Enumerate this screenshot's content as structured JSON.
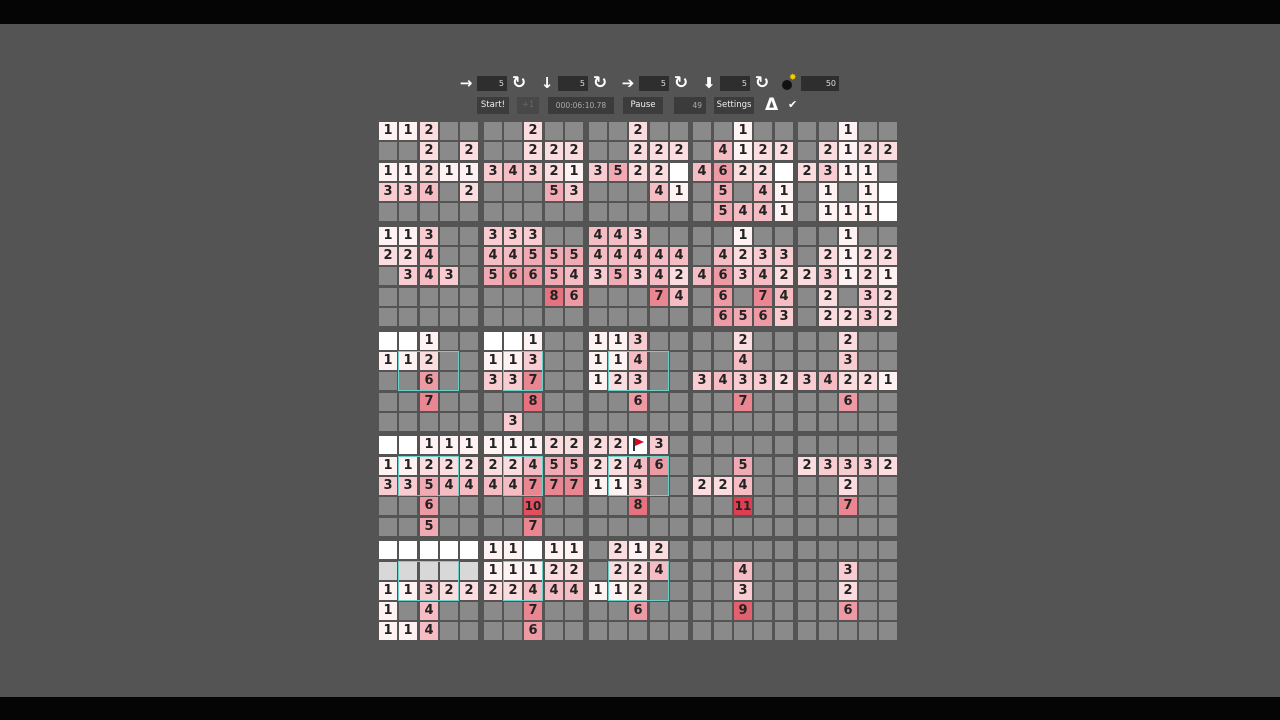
{
  "controls": {
    "move_right_value": "5",
    "move_down_value": "5",
    "move_right_fast_value": "5",
    "move_down_fast_value": "5",
    "mine_count": "50"
  },
  "buttons": {
    "start": "Start!",
    "step": "+1",
    "pause": "Pause",
    "settings": "Settings"
  },
  "status": {
    "timer": "000:06:10.78",
    "remaining": "49"
  },
  "colors": {
    "background": "#545454",
    "hidden_cell": "#8a8a8a",
    "revealed_cell": "#ffffff",
    "hint_outline": "#6bd0c8",
    "flag": "#e00020"
  },
  "grid": {
    "block_size": 5,
    "blocks": 5,
    "rows": [
      [
        "1",
        "1",
        "2",
        ".",
        ".",
        ".",
        ".",
        "2",
        ".",
        ".",
        ".",
        ".",
        "2",
        ".",
        ".",
        ".",
        ".",
        "1",
        ".",
        ".",
        ".",
        ".",
        "1",
        ".",
        "."
      ],
      [
        ".",
        ".",
        "2",
        ".",
        "2",
        ".",
        ".",
        "2",
        "2",
        "2",
        ".",
        ".",
        "2",
        "2",
        "2",
        ".",
        "4",
        "1",
        "2",
        "2",
        ".",
        "2",
        "1",
        "2",
        "2"
      ],
      [
        "1",
        "1",
        "2",
        "1",
        "1",
        "3",
        "4",
        "3",
        "2",
        "1",
        "3",
        "5",
        "2",
        "2",
        "0",
        "4",
        "6",
        "2",
        "2",
        "0",
        "2",
        "3",
        "1",
        "1",
        "."
      ],
      [
        "3",
        "3",
        "4",
        ".",
        "2",
        ".",
        ".",
        ".",
        "5",
        "3",
        ".",
        ".",
        ".",
        "4",
        "1",
        ".",
        "5",
        ".",
        "4",
        "1",
        ".",
        "1",
        ".",
        "1",
        "0"
      ],
      [
        ".",
        ".",
        ".",
        ".",
        ".",
        ".",
        ".",
        ".",
        ".",
        ".",
        ".",
        ".",
        ".",
        ".",
        ".",
        ".",
        "5",
        "4",
        "4",
        "1",
        ".",
        "1",
        "1",
        "1",
        "0"
      ],
      [
        "1",
        "1",
        "3",
        ".",
        ".",
        "3",
        "3",
        "3",
        ".",
        ".",
        "4",
        "4",
        "3",
        ".",
        ".",
        ".",
        ".",
        "1",
        ".",
        ".",
        ".",
        ".",
        "1",
        ".",
        "."
      ],
      [
        "2",
        "2",
        "4",
        ".",
        ".",
        "4",
        "4",
        "5",
        "5",
        "5",
        "4",
        "4",
        "4",
        "4",
        "4",
        ".",
        "4",
        "2",
        "3",
        "3",
        ".",
        "2",
        "1",
        "2",
        "2"
      ],
      [
        ".",
        "3",
        "4",
        "3",
        ".",
        "5",
        "6",
        "6",
        "5",
        "4",
        "3",
        "5",
        "3",
        "4",
        "2",
        "4",
        "6",
        "3",
        "4",
        "2",
        "2",
        "3",
        "1",
        "2",
        "1"
      ],
      [
        ".",
        ".",
        ".",
        ".",
        ".",
        ".",
        ".",
        ".",
        "8",
        "6",
        ".",
        ".",
        ".",
        "7",
        "4",
        ".",
        "6",
        ".",
        "7",
        "4",
        ".",
        "2",
        ".",
        "3",
        "2"
      ],
      [
        ".",
        ".",
        ".",
        ".",
        ".",
        ".",
        ".",
        ".",
        ".",
        ".",
        ".",
        ".",
        ".",
        ".",
        ".",
        ".",
        "6",
        "5",
        "6",
        "3",
        ".",
        "2",
        "2",
        "3",
        "2"
      ],
      [
        "0",
        "0",
        "1",
        ".",
        ".",
        "0",
        "0",
        "1",
        ".",
        ".",
        "1",
        "1",
        "3",
        ".",
        ".",
        ".",
        ".",
        "2",
        ".",
        ".",
        ".",
        ".",
        "2",
        ".",
        "."
      ],
      [
        "1",
        "1",
        "2",
        ".",
        ".",
        "1",
        "1",
        "3",
        ".",
        ".",
        "1",
        "1",
        "4",
        ".",
        ".",
        ".",
        ".",
        "4",
        ".",
        ".",
        ".",
        ".",
        "3",
        ".",
        "."
      ],
      [
        ".",
        ".",
        "6",
        ".",
        ".",
        "3",
        "3",
        "7",
        ".",
        ".",
        "1",
        "2",
        "3",
        ".",
        ".",
        "3",
        "4",
        "3",
        "3",
        "2",
        "3",
        "4",
        "2",
        "2",
        "1"
      ],
      [
        ".",
        ".",
        "7",
        ".",
        ".",
        ".",
        ".",
        "8",
        ".",
        ".",
        ".",
        ".",
        "6",
        ".",
        ".",
        ".",
        ".",
        "7",
        ".",
        ".",
        ".",
        ".",
        "6",
        ".",
        "."
      ],
      [
        ".",
        ".",
        ".",
        ".",
        ".",
        ".",
        "3",
        ".",
        ".",
        ".",
        ".",
        ".",
        ".",
        ".",
        ".",
        ".",
        ".",
        ".",
        ".",
        ".",
        ".",
        ".",
        ".",
        ".",
        "."
      ],
      [
        "0",
        "0",
        "1",
        "1",
        "1",
        "1",
        "1",
        "1",
        "2",
        "2",
        "2",
        "2",
        "F",
        "3",
        ".",
        ".",
        ".",
        ".",
        ".",
        ".",
        ".",
        ".",
        ".",
        ".",
        "."
      ],
      [
        "1",
        "1",
        "2",
        "2",
        "2",
        "2",
        "2",
        "4",
        "5",
        "5",
        "2",
        "2",
        "4",
        "6",
        ".",
        ".",
        ".",
        "5",
        ".",
        ".",
        "2",
        "3",
        "3",
        "3",
        "2"
      ],
      [
        "3",
        "3",
        "5",
        "4",
        "4",
        "4",
        "4",
        "7",
        "7",
        "7",
        "1",
        "1",
        "3",
        ".",
        ".",
        "2",
        "2",
        "4",
        ".",
        ".",
        ".",
        ".",
        "2",
        ".",
        "."
      ],
      [
        ".",
        ".",
        "6",
        ".",
        ".",
        ".",
        ".",
        "10",
        ".",
        ".",
        ".",
        ".",
        "8",
        ".",
        ".",
        ".",
        ".",
        "11",
        ".",
        ".",
        ".",
        ".",
        "7",
        ".",
        "."
      ],
      [
        ".",
        ".",
        "5",
        ".",
        ".",
        ".",
        ".",
        "7",
        ".",
        ".",
        ".",
        ".",
        ".",
        ".",
        ".",
        ".",
        ".",
        ".",
        ".",
        ".",
        ".",
        ".",
        ".",
        ".",
        "."
      ],
      [
        "0",
        "0",
        "0",
        "0",
        "0",
        "1",
        "1",
        "0",
        "1",
        "1",
        ".",
        "2",
        "1",
        "2",
        ".",
        ".",
        ".",
        ".",
        ".",
        ".",
        ".",
        ".",
        ".",
        ".",
        "."
      ],
      [
        "f",
        "f",
        "f",
        "f",
        "f",
        "1",
        "1",
        "1",
        "2",
        "2",
        ".",
        "2",
        "2",
        "4",
        ".",
        ".",
        ".",
        "4",
        ".",
        ".",
        ".",
        ".",
        "3",
        ".",
        "."
      ],
      [
        "1",
        "1",
        "3",
        "2",
        "2",
        "2",
        "2",
        "4",
        "4",
        "4",
        "1",
        "1",
        "2",
        ".",
        ".",
        ".",
        ".",
        "3",
        ".",
        ".",
        ".",
        ".",
        "2",
        ".",
        "."
      ],
      [
        "1",
        ".",
        "4",
        ".",
        ".",
        ".",
        ".",
        "7",
        ".",
        ".",
        ".",
        ".",
        "6",
        ".",
        ".",
        ".",
        ".",
        "9",
        ".",
        ".",
        ".",
        ".",
        "6",
        ".",
        "."
      ],
      [
        "1",
        "1",
        "4",
        ".",
        ".",
        ".",
        ".",
        "6",
        ".",
        ".",
        ".",
        ".",
        ".",
        ".",
        ".",
        ".",
        ".",
        ".",
        ".",
        ".",
        ".",
        ".",
        ".",
        ".",
        "."
      ]
    ]
  }
}
